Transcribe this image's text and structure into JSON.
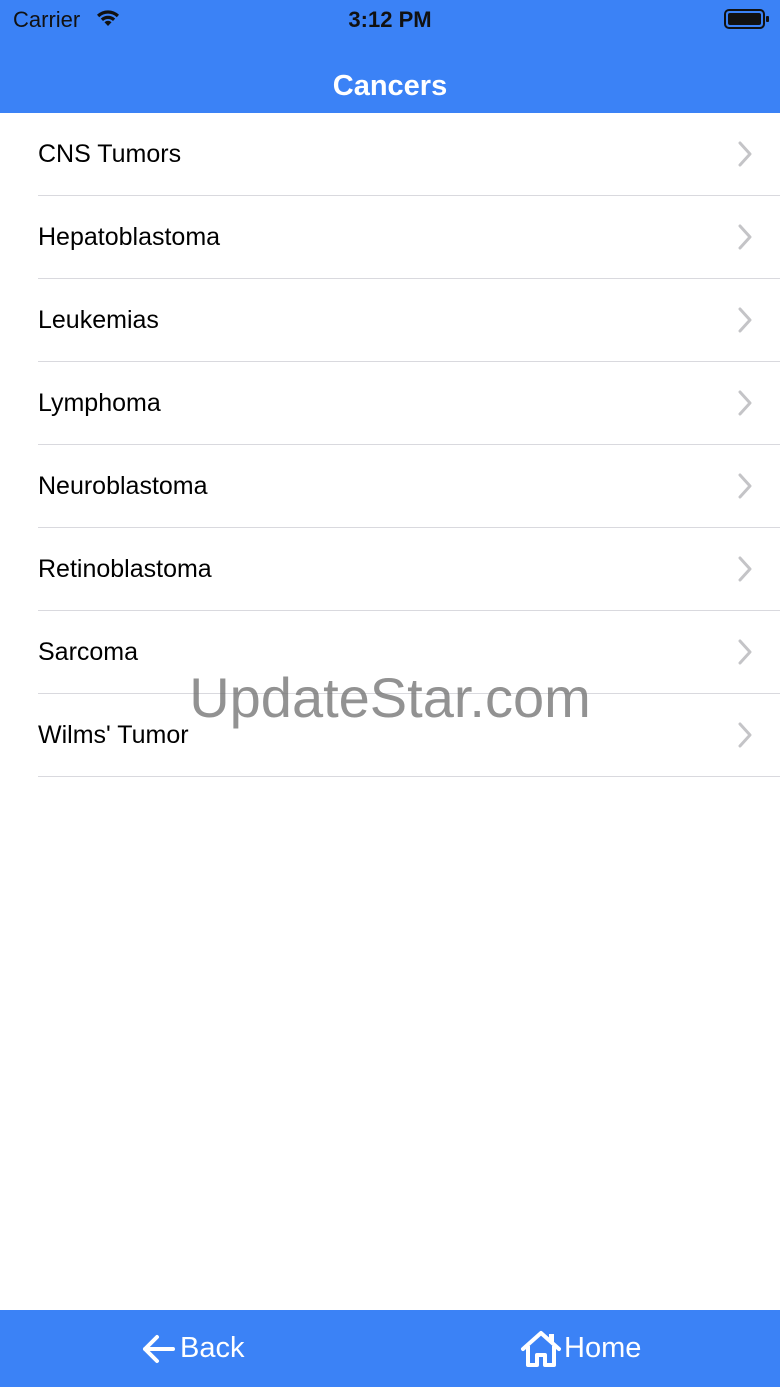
{
  "status_bar": {
    "carrier": "Carrier",
    "time": "3:12 PM"
  },
  "nav": {
    "title": "Cancers"
  },
  "list": {
    "items": [
      {
        "label": "CNS Tumors"
      },
      {
        "label": "Hepatoblastoma"
      },
      {
        "label": "Leukemias"
      },
      {
        "label": "Lymphoma"
      },
      {
        "label": "Neuroblastoma"
      },
      {
        "label": "Retinoblastoma"
      },
      {
        "label": "Sarcoma"
      },
      {
        "label": "Wilms' Tumor"
      }
    ]
  },
  "watermark": "UpdateStar.com",
  "toolbar": {
    "back_label": "Back",
    "home_label": "Home"
  },
  "colors": {
    "brand_blue": "#3b82f6",
    "chevron": "#c4c4c7",
    "separator": "#d9d9de"
  },
  "icons": {
    "wifi": "wifi-icon",
    "battery": "battery-icon",
    "chevron": "chevron-right-icon",
    "back": "arrow-left-icon",
    "home": "home-icon"
  }
}
